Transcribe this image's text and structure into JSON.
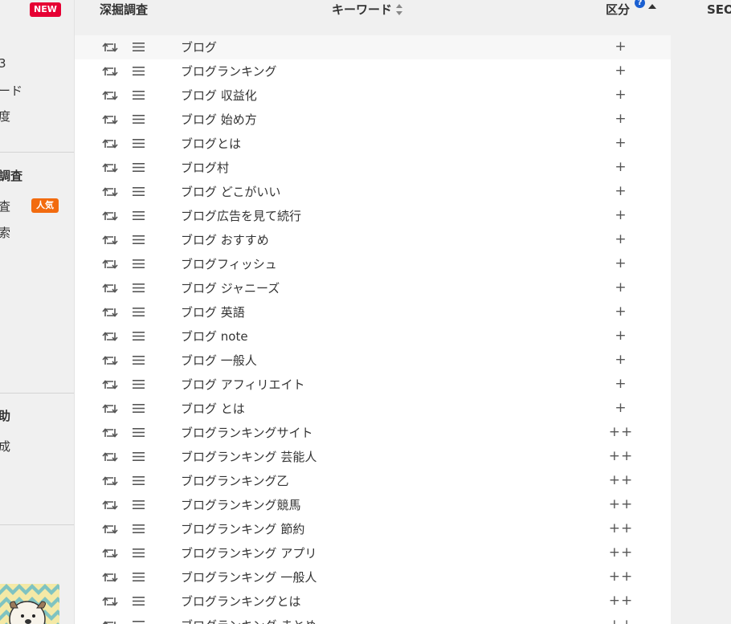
{
  "sidebar": {
    "new_badge": "NEW",
    "popular_badge": "人気",
    "items": [
      {
        "label": "3"
      },
      {
        "label": "ード"
      },
      {
        "label": "度"
      },
      {
        "label": "調査"
      },
      {
        "label": "査"
      },
      {
        "label": "索"
      },
      {
        "label": "助"
      },
      {
        "label": "成"
      }
    ]
  },
  "table": {
    "headers": {
      "deep_search": "深掘調査",
      "keyword": "キーワード",
      "category": "区分",
      "seo": "SEO"
    },
    "help_icon_label": "?",
    "rows": [
      {
        "keyword": "ブログ",
        "category": "+"
      },
      {
        "keyword": "ブログランキング",
        "category": "+"
      },
      {
        "keyword": "ブログ 収益化",
        "category": "+"
      },
      {
        "keyword": "ブログ 始め方",
        "category": "+"
      },
      {
        "keyword": "ブログとは",
        "category": "+"
      },
      {
        "keyword": "ブログ村",
        "category": "+"
      },
      {
        "keyword": "ブログ どこがいい",
        "category": "+"
      },
      {
        "keyword": "ブログ広告を見て続行",
        "category": "+"
      },
      {
        "keyword": "ブログ おすすめ",
        "category": "+"
      },
      {
        "keyword": "ブログフィッシュ",
        "category": "+"
      },
      {
        "keyword": "ブログ ジャニーズ",
        "category": "+"
      },
      {
        "keyword": "ブログ 英語",
        "category": "+"
      },
      {
        "keyword": "ブログ note",
        "category": "+"
      },
      {
        "keyword": "ブログ 一般人",
        "category": "+"
      },
      {
        "keyword": "ブログ アフィリエイト",
        "category": "+"
      },
      {
        "keyword": "ブログ とは",
        "category": "+"
      },
      {
        "keyword": "ブログランキングサイト",
        "category": "++"
      },
      {
        "keyword": "ブログランキング 芸能人",
        "category": "++"
      },
      {
        "keyword": "ブログランキング乙",
        "category": "++"
      },
      {
        "keyword": "ブログランキング競馬",
        "category": "++"
      },
      {
        "keyword": "ブログランキング 節約",
        "category": "++"
      },
      {
        "keyword": "ブログランキング アプリ",
        "category": "++"
      },
      {
        "keyword": "ブログランキング 一般人",
        "category": "++"
      },
      {
        "keyword": "ブログランキングとは",
        "category": "++"
      },
      {
        "keyword": "ブログランキング まとめ",
        "category": "++"
      }
    ]
  },
  "colors": {
    "new_badge": "#e60033",
    "popular_badge": "#f26b0f",
    "help_icon": "#1a5fd1",
    "sidebar_bg": "#f0f0f0",
    "table_bg": "#ffffff"
  }
}
